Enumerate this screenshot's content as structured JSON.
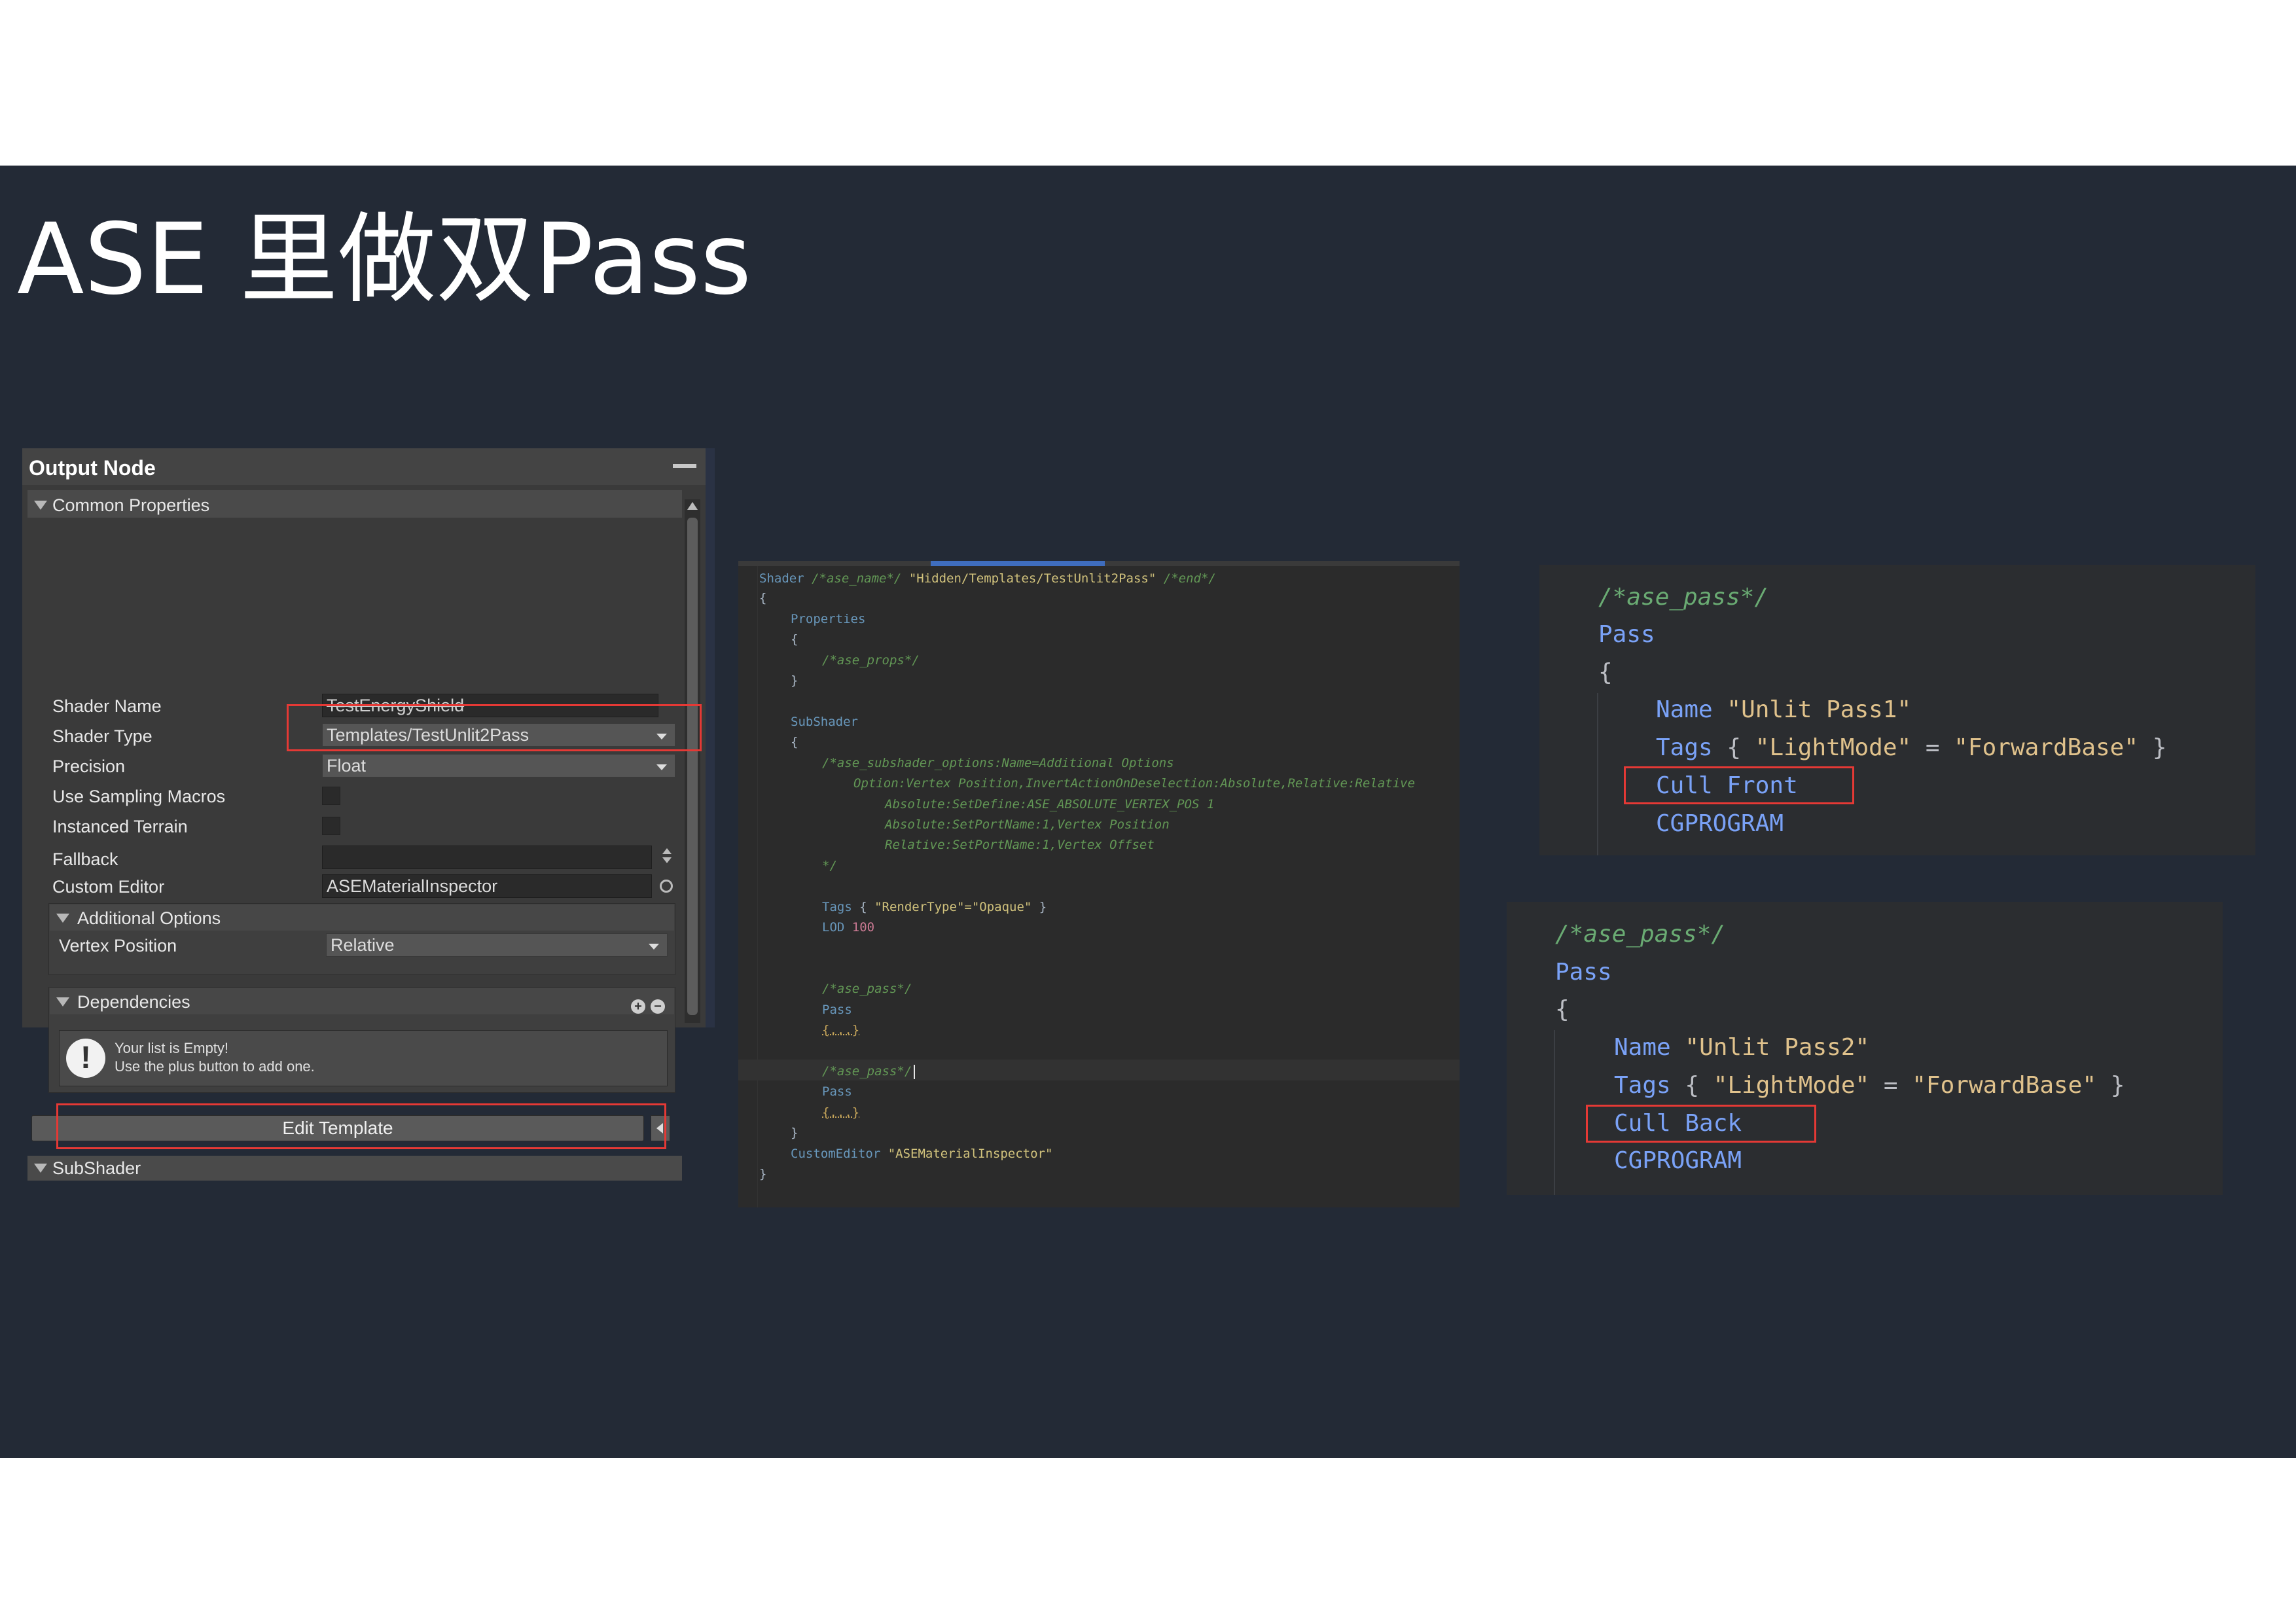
{
  "slide": {
    "title": "ASE 里做双Pass"
  },
  "output_node": {
    "title": "Output Node",
    "sections": {
      "common_properties": "Common Properties",
      "additional_options": "Additional Options",
      "dependencies": "Dependencies",
      "subshader": "SubShader"
    },
    "rows": {
      "shader_name_label": "Shader Name",
      "shader_name_value": "TestEnergyShield",
      "shader_type_label": "Shader Type",
      "shader_type_value": "Templates/TestUnlit2Pass",
      "precision_label": "Precision",
      "precision_value": "Float",
      "sampling_macros_label": "Use Sampling Macros",
      "instanced_terrain_label": "Instanced Terrain",
      "fallback_label": "Fallback",
      "fallback_value": "",
      "custom_editor_label": "Custom Editor",
      "custom_editor_value": "ASEMaterialInspector",
      "vertex_position_label": "Vertex Position",
      "vertex_position_value": "Relative"
    },
    "dependencies_empty": {
      "line1": "Your list is Empty!",
      "line2": "Use the plus button to add one."
    },
    "edit_template_button": "Edit Template"
  },
  "code_editor": {
    "lines": {
      "l1_kw": "Shader",
      "l1_cm": "/*ase_name*/",
      "l1_st": "\"Hidden/Templates/TestUnlit2Pass\"",
      "l1_cm2": "/*end*/",
      "l2": "{",
      "l3": "Properties",
      "l4": "{",
      "l5": "/*ase_props*/",
      "l6": "}",
      "l7": "SubShader",
      "l8": "{",
      "l9": "/*ase_subshader_options:Name=Additional Options",
      "l10": "Option:Vertex Position,InvertActionOnDeselection:Absolute,Relative:Relative",
      "l11": "Absolute:SetDefine:ASE_ABSOLUTE_VERTEX_POS 1",
      "l12": "Absolute:SetPortName:1,Vertex Position",
      "l13": "Relative:SetPortName:1,Vertex Offset",
      "l14": "*/",
      "l15_kw": "Tags",
      "l15_rest": "{ ",
      "l15_st": "\"RenderType\"=\"Opaque\"",
      "l15_end": " }",
      "l16_kw": "LOD",
      "l16_num": "100",
      "l17": "/*ase_pass*/",
      "l18": "Pass",
      "l19": "{...}",
      "l20": "/*ase_pass*/",
      "l21": "Pass",
      "l22": "{...}",
      "l23": "}",
      "l24_kw": "CustomEditor",
      "l24_st": "\"ASEMaterialInspector\"",
      "l25": "}"
    }
  },
  "zoom_pass1": {
    "comment": "/*ase_pass*/",
    "pass": "Pass",
    "brace": "{",
    "name_kw": "Name",
    "name_val": "\"Unlit Pass1\"",
    "tags_kw": "Tags",
    "tags_open": "{",
    "tags_key": "\"LightMode\"",
    "tags_eq": "=",
    "tags_val": "\"ForwardBase\"",
    "tags_close": "}",
    "cull": "Cull Front",
    "cg": "CGPROGRAM"
  },
  "zoom_pass2": {
    "comment": "/*ase_pass*/",
    "pass": "Pass",
    "brace": "{",
    "name_kw": "Name",
    "name_val": "\"Unlit Pass2\"",
    "tags_kw": "Tags",
    "tags_open": "{",
    "tags_key": "\"LightMode\"",
    "tags_eq": "=",
    "tags_val": "\"ForwardBase\"",
    "tags_close": "}",
    "cull": "Cull Back",
    "cg": "CGPROGRAM"
  },
  "colors": {
    "slide_bg": "#232a36",
    "highlight_red": "#e53935",
    "keyword_blue": "#7aa2f7",
    "string_gold": "#e0c28c",
    "comment_green": "#6aab73"
  }
}
